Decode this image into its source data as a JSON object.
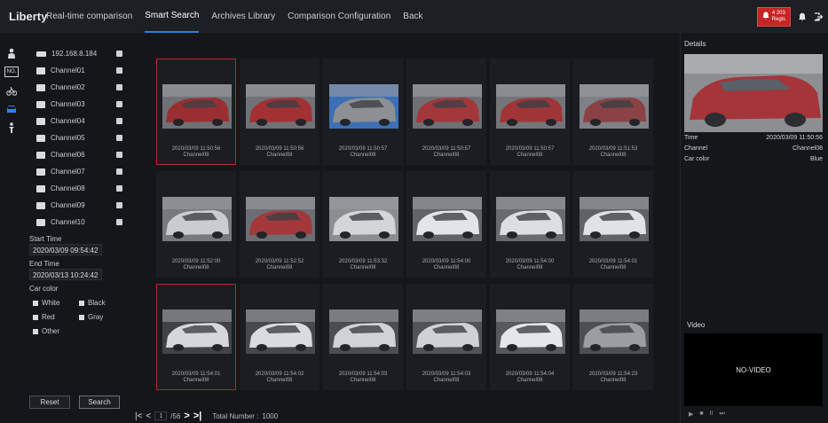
{
  "app": {
    "logo": "Liberty"
  },
  "nav": {
    "items": [
      {
        "label": "Real-time comparison",
        "active": false
      },
      {
        "label": "Smart Search",
        "active": true
      },
      {
        "label": "Archives Library",
        "active": false
      },
      {
        "label": "Comparison Configuration",
        "active": false
      },
      {
        "label": "Back",
        "active": false
      }
    ]
  },
  "topright": {
    "alarm_line1": "4 203",
    "alarm_line2": "Regis",
    "bell_icon": "bell-icon",
    "logout_icon": "logout-icon"
  },
  "sidebar_icons": [
    "person-icon",
    "plate-icon",
    "bicycle-icon",
    "car-icon",
    "walker-icon"
  ],
  "device": {
    "host": "192.168.8.184",
    "channels": [
      "Channel01",
      "Channel02",
      "Channel03",
      "Channel04",
      "Channel05",
      "Channel06",
      "Channel07",
      "Channel08",
      "Channel09",
      "Channel10"
    ]
  },
  "filters": {
    "start_label": "Start Time",
    "start_value": "2020/03/09 09:54:42",
    "end_label": "End Time",
    "end_value": "2020/03/13 10:24:42",
    "color_label": "Car color",
    "colors": [
      "White",
      "Black",
      "Red",
      "Gray",
      "Other"
    ],
    "reset_label": "Reset",
    "search_label": "Search"
  },
  "results": [
    {
      "time": "2020/03/09 11:50:56",
      "channel": "Channel08",
      "selected": true,
      "car": "#9a2e30",
      "bg": "#6f7176"
    },
    {
      "time": "2020/03/09 11:50:56",
      "channel": "Channel08",
      "selected": false,
      "car": "#a23133",
      "bg": "#707277"
    },
    {
      "time": "2020/03/09 11:50:57",
      "channel": "Channel08",
      "selected": false,
      "car": "#8c8f93",
      "bg": "#3c6fb5"
    },
    {
      "time": "2020/03/09 11:50:57",
      "channel": "Channel08",
      "selected": false,
      "car": "#a3373a",
      "bg": "#6e7075"
    },
    {
      "time": "2020/03/09 11:50:57",
      "channel": "Channel08",
      "selected": false,
      "car": "#a03537",
      "bg": "#737579"
    },
    {
      "time": "2020/03/09 11:51:53",
      "channel": "Channel08",
      "selected": false,
      "car": "#8a4244",
      "bg": "#7e8186"
    },
    {
      "time": "2020/03/09 11:52:00",
      "channel": "Channel08",
      "selected": false,
      "car": "#c9ccd0",
      "bg": "#77797d"
    },
    {
      "time": "2020/03/09 11:52:52",
      "channel": "Channel08",
      "selected": false,
      "car": "#a1383a",
      "bg": "#6c6e73"
    },
    {
      "time": "2020/03/09 11:53:32",
      "channel": "Channel08",
      "selected": false,
      "car": "#d3d5d8",
      "bg": "#8b8d91"
    },
    {
      "time": "2020/03/09 11:54:00",
      "channel": "Channel08",
      "selected": false,
      "car": "#e2e4e7",
      "bg": "#606368"
    },
    {
      "time": "2020/03/09 11:54:00",
      "channel": "Channel08",
      "selected": false,
      "car": "#dcdee1",
      "bg": "#676a6f"
    },
    {
      "time": "2020/03/09 11:54:01",
      "channel": "Channel08",
      "selected": false,
      "car": "#e0e2e5",
      "bg": "#5f6267"
    },
    {
      "time": "2020/03/09 11:54:01",
      "channel": "Channel08",
      "selected": true,
      "car": "#d5d7da",
      "bg": "#3f4247"
    },
    {
      "time": "2020/03/09 11:54:02",
      "channel": "Channel08",
      "selected": false,
      "car": "#d9dbde",
      "bg": "#45484d"
    },
    {
      "time": "2020/03/09 11:54:03",
      "channel": "Channel08",
      "selected": false,
      "car": "#d0d2d5",
      "bg": "#4a4d52"
    },
    {
      "time": "2020/03/09 11:54:03",
      "channel": "Channel08",
      "selected": false,
      "car": "#cfd1d4",
      "bg": "#505358"
    },
    {
      "time": "2020/03/09 11:54:04",
      "channel": "Channel08",
      "selected": false,
      "car": "#e4e6e9",
      "bg": "#56595e"
    },
    {
      "time": "2020/03/09 11:54:23",
      "channel": "Channel08",
      "selected": false,
      "car": "#9a9da2",
      "bg": "#4b4e53"
    }
  ],
  "pager": {
    "first": "|<",
    "prev": "<",
    "current": "1",
    "total_pages": "/56",
    "next": ">",
    "last": ">|",
    "total_label": "Total Number :",
    "total_value": "1000"
  },
  "details": {
    "title": "Details",
    "time_label": "Time",
    "time_value": "2020/03/09 11:50:56",
    "channel_label": "Channel",
    "channel_value": "Channel08",
    "color_label": "Car color",
    "color_value": "Blue"
  },
  "video": {
    "title": "Video",
    "placeholder": "NO-VIDEO",
    "controls": [
      "▶",
      "■",
      "II",
      "⏭"
    ]
  },
  "colors": {
    "accent": "#2c7fd6",
    "alarm": "#c82325",
    "selected_border": "#b32a2a"
  }
}
